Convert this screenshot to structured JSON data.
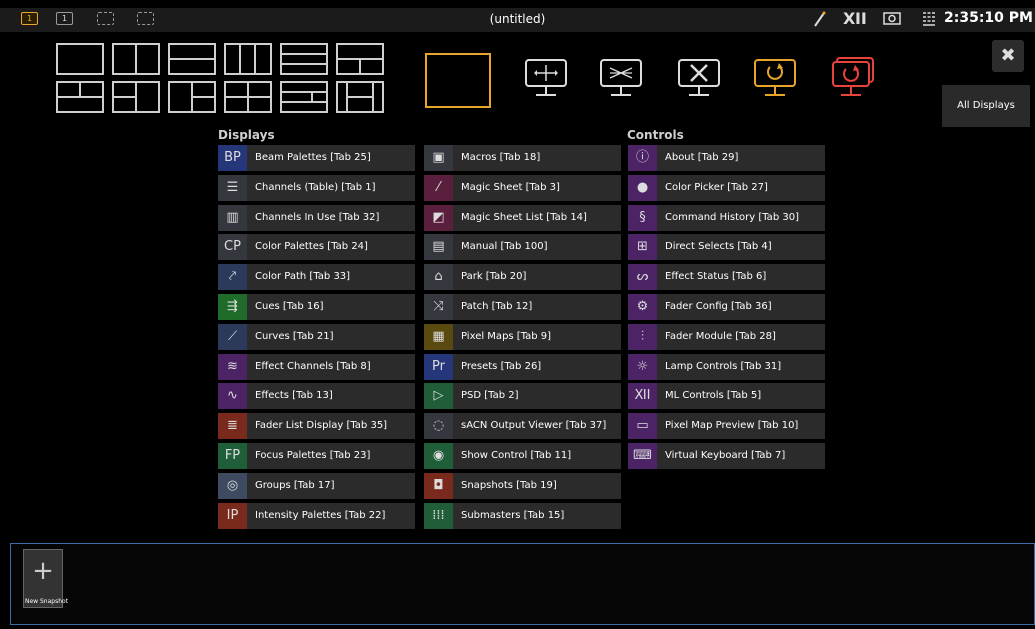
{
  "topbar": {
    "workspaces": [
      {
        "label": "1",
        "active": true
      },
      {
        "label": "1",
        "active": false
      },
      {
        "label": "",
        "active": false
      },
      {
        "label": "",
        "active": false
      }
    ],
    "title": "(untitled)",
    "clock": "2:35:10 PM"
  },
  "close_label": "✖",
  "all_displays_label": "All Displays",
  "columns": {
    "displays_title": "Displays",
    "controls_title": "Controls"
  },
  "displays_col1": [
    {
      "label": "Beam Palettes [Tab 25]",
      "icon_text": "BP",
      "icon_bg": "#26367a",
      "icon": "beam-palettes-icon"
    },
    {
      "label": "Channels (Table) [Tab 1]",
      "icon_text": "☰",
      "icon_bg": "#34373d",
      "icon": "channels-table-icon"
    },
    {
      "label": "Channels In Use [Tab 32]",
      "icon_text": "▥",
      "icon_bg": "#34373d",
      "icon": "channels-in-use-icon"
    },
    {
      "label": "Color Palettes [Tab 24]",
      "icon_text": "CP",
      "icon_bg": "#34373d",
      "icon": "color-palettes-icon"
    },
    {
      "label": "Color Path [Tab 33]",
      "icon_text": "⤤",
      "icon_bg": "#2b3a5a",
      "icon": "color-path-icon"
    },
    {
      "label": "Cues [Tab 16]",
      "icon_text": "⇶",
      "icon_bg": "#1f6b2a",
      "icon": "cues-icon"
    },
    {
      "label": "Curves [Tab 21]",
      "icon_text": "⟋",
      "icon_bg": "#2b3a5a",
      "icon": "curves-icon"
    },
    {
      "label": "Effect Channels [Tab 8]",
      "icon_text": "≋",
      "icon_bg": "#4c2466",
      "icon": "effect-channels-icon"
    },
    {
      "label": "Effects [Tab 13]",
      "icon_text": "∿",
      "icon_bg": "#4c2466",
      "icon": "effects-icon"
    },
    {
      "label": "Fader List Display [Tab 35]",
      "icon_text": "≣",
      "icon_bg": "#7a2a1c",
      "icon": "fader-list-icon"
    },
    {
      "label": "Focus Palettes [Tab 23]",
      "icon_text": "FP",
      "icon_bg": "#1f5e38",
      "icon": "focus-palettes-icon"
    },
    {
      "label": "Groups [Tab 17]",
      "icon_text": "◎",
      "icon_bg": "#3d4a60",
      "icon": "groups-icon"
    },
    {
      "label": "Intensity Palettes [Tab 22]",
      "icon_text": "IP",
      "icon_bg": "#7a2a1c",
      "icon": "intensity-palettes-icon"
    }
  ],
  "displays_col2": [
    {
      "label": "Macros [Tab 18]",
      "icon_text": "▣",
      "icon_bg": "#34373d",
      "icon": "macros-icon"
    },
    {
      "label": "Magic Sheet [Tab 3]",
      "icon_text": "⁄",
      "icon_bg": "#5a1f3c",
      "icon": "magic-sheet-icon"
    },
    {
      "label": "Magic Sheet List [Tab 14]",
      "icon_text": "◩",
      "icon_bg": "#5a1f3c",
      "icon": "magic-sheet-list-icon"
    },
    {
      "label": "Manual [Tab 100]",
      "icon_text": "▤",
      "icon_bg": "#34373d",
      "icon": "manual-icon"
    },
    {
      "label": "Park [Tab 20]",
      "icon_text": "⌂",
      "icon_bg": "#34373d",
      "icon": "park-icon"
    },
    {
      "label": "Patch [Tab 12]",
      "icon_text": "⤨",
      "icon_bg": "#34373d",
      "icon": "patch-icon"
    },
    {
      "label": "Pixel Maps [Tab 9]",
      "icon_text": "▦",
      "icon_bg": "#5a4a10",
      "icon": "pixel-maps-icon"
    },
    {
      "label": "Presets [Tab 26]",
      "icon_text": "Pr",
      "icon_bg": "#26367a",
      "icon": "presets-icon"
    },
    {
      "label": "PSD [Tab 2]",
      "icon_text": "▷",
      "icon_bg": "#1f5e38",
      "icon": "psd-icon"
    },
    {
      "label": "sACN Output Viewer [Tab 37]",
      "icon_text": "◌",
      "icon_bg": "#34373d",
      "icon": "sacn-viewer-icon"
    },
    {
      "label": "Show Control [Tab 11]",
      "icon_text": "◉",
      "icon_bg": "#1f5e38",
      "icon": "show-control-icon"
    },
    {
      "label": "Snapshots [Tab 19]",
      "icon_text": "◘",
      "icon_bg": "#7a2a1c",
      "icon": "snapshots-icon"
    },
    {
      "label": "Submasters [Tab 15]",
      "icon_text": "⁞⁞⁞",
      "icon_bg": "#1f5e38",
      "icon": "submasters-icon"
    }
  ],
  "controls_col": [
    {
      "label": "About [Tab 29]",
      "icon_text": "ⓘ",
      "icon_bg": "#4c2466",
      "icon": "about-icon"
    },
    {
      "label": "Color Picker [Tab 27]",
      "icon_text": "●",
      "icon_bg": "#4c2466",
      "icon": "color-picker-icon"
    },
    {
      "label": "Command History [Tab 30]",
      "icon_text": "§",
      "icon_bg": "#4c2466",
      "icon": "command-history-icon"
    },
    {
      "label": "Direct Selects [Tab 4]",
      "icon_text": "⊞",
      "icon_bg": "#4c2466",
      "icon": "direct-selects-icon"
    },
    {
      "label": "Effect Status [Tab 6]",
      "icon_text": "ᔕ",
      "icon_bg": "#4c2466",
      "icon": "effect-status-icon"
    },
    {
      "label": "Fader Config [Tab 36]",
      "icon_text": "⚙",
      "icon_bg": "#4c2466",
      "icon": "fader-config-icon"
    },
    {
      "label": "Fader Module [Tab 28]",
      "icon_text": "⫶",
      "icon_bg": "#4c2466",
      "icon": "fader-module-icon"
    },
    {
      "label": "Lamp Controls [Tab 31]",
      "icon_text": "☼",
      "icon_bg": "#4c2466",
      "icon": "lamp-controls-icon"
    },
    {
      "label": "ML Controls [Tab 5]",
      "icon_text": "ⅪⅠ",
      "icon_bg": "#4c2466",
      "icon": "ml-controls-icon"
    },
    {
      "label": "Pixel Map Preview [Tab 10]",
      "icon_text": "▭",
      "icon_bg": "#4c2466",
      "icon": "pixel-map-preview-icon"
    },
    {
      "label": "Virtual Keyboard [Tab 7]",
      "icon_text": "⌨",
      "icon_bg": "#4c2466",
      "icon": "virtual-keyboard-icon"
    }
  ],
  "snapshot": {
    "label": "New Snapshot",
    "plus": "+"
  },
  "colors": {
    "accent": "#e8a52c",
    "red": "#e8433a",
    "frame_blue": "#3d6da8"
  }
}
